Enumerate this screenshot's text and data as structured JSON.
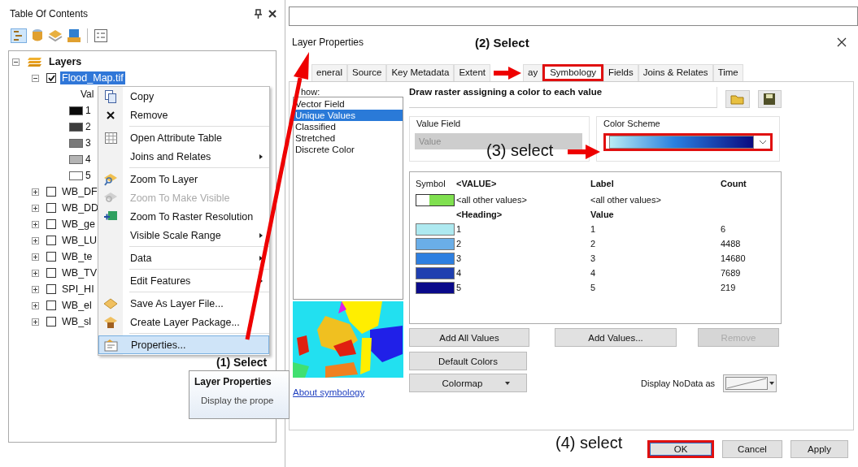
{
  "toc": {
    "title": "Table Of Contents",
    "tree": [
      {
        "label": "Layers",
        "expanded": true,
        "children": [
          {
            "label": "Flood_Map.tif",
            "checked": true,
            "selected": true,
            "expanded": true,
            "legend": {
              "heading": "Val",
              "items": [
                {
                  "label": "1",
                  "color": "#0a0a0a"
                },
                {
                  "label": "2",
                  "color": "#3c3c3c"
                },
                {
                  "label": "3",
                  "color": "#7a7a7a"
                },
                {
                  "label": "4",
                  "color": "#b4b4b4"
                },
                {
                  "label": "5",
                  "color": "#ffffff"
                }
              ]
            }
          },
          {
            "label": "WB_DF",
            "checked": false,
            "selected": false,
            "expanded": false
          },
          {
            "label": "WB_DD",
            "checked": false,
            "selected": false,
            "expanded": false
          },
          {
            "label": "WB_ge",
            "checked": false,
            "selected": false,
            "expanded": false
          },
          {
            "label": "WB_LU",
            "checked": false,
            "selected": false,
            "expanded": false
          },
          {
            "label": "WB_te",
            "checked": false,
            "selected": false,
            "expanded": false
          },
          {
            "label": "WB_TV",
            "checked": false,
            "selected": false,
            "expanded": false
          },
          {
            "label": "SPI_HI",
            "checked": false,
            "selected": false,
            "expanded": false
          },
          {
            "label": "WB_el",
            "checked": false,
            "selected": false,
            "expanded": false
          },
          {
            "label": "WB_sl",
            "checked": false,
            "selected": false,
            "expanded": false
          }
        ]
      }
    ]
  },
  "context_menu": {
    "groups": [
      [
        {
          "label": "Copy",
          "submenu": false,
          "disabled": false,
          "selected": false
        },
        {
          "label": "Remove",
          "submenu": false,
          "disabled": false,
          "selected": false
        }
      ],
      [
        {
          "label": "Open Attribute Table",
          "submenu": false,
          "disabled": false,
          "selected": false
        },
        {
          "label": "Joins and Relates",
          "submenu": true,
          "disabled": false,
          "selected": false
        }
      ],
      [
        {
          "label": "Zoom To Layer",
          "submenu": false,
          "disabled": false,
          "selected": false
        },
        {
          "label": "Zoom To Make Visible",
          "submenu": false,
          "disabled": true,
          "selected": false
        },
        {
          "label": "Zoom To Raster Resolution",
          "submenu": false,
          "disabled": false,
          "selected": false
        },
        {
          "label": "Visible Scale Range",
          "submenu": true,
          "disabled": false,
          "selected": false
        }
      ],
      [
        {
          "label": "Data",
          "submenu": true,
          "disabled": false,
          "selected": false
        }
      ],
      [
        {
          "label": "Edit Features",
          "submenu": true,
          "disabled": false,
          "selected": false
        }
      ],
      [
        {
          "label": "Save As Layer File...",
          "submenu": false,
          "disabled": false,
          "selected": false
        },
        {
          "label": "Create Layer Package...",
          "submenu": false,
          "disabled": false,
          "selected": false
        }
      ],
      [
        {
          "label": "Properties...",
          "submenu": false,
          "disabled": false,
          "selected": true
        }
      ]
    ]
  },
  "tooltip": {
    "title": "Layer Properties",
    "text": "Display the prope"
  },
  "dialog": {
    "title": "Layer Properties",
    "tabs": [
      {
        "label": "eneral",
        "selected": false,
        "highlighted": false
      },
      {
        "label": "Source",
        "selected": false,
        "highlighted": false
      },
      {
        "label": "Key Metadata",
        "selected": false,
        "highlighted": false
      },
      {
        "label": "Extent",
        "selected": false,
        "highlighted": false
      },
      {
        "label": "ay",
        "selected": false,
        "highlighted": false
      },
      {
        "label": "Symbology",
        "selected": true,
        "highlighted": true
      },
      {
        "label": "Fields",
        "selected": false,
        "highlighted": false
      },
      {
        "label": "Joins & Relates",
        "selected": false,
        "highlighted": false
      },
      {
        "label": "Time",
        "selected": false,
        "highlighted": false
      }
    ],
    "show": {
      "label": "how:",
      "items": [
        {
          "label": "Vector Field",
          "selected": false
        },
        {
          "label": "Unique Values",
          "selected": true
        },
        {
          "label": "Classified",
          "selected": false
        },
        {
          "label": "Stretched",
          "selected": false
        },
        {
          "label": "Discrete Color",
          "selected": false
        }
      ]
    },
    "about_link": "About symbology",
    "description": "Draw raster assigning a color to each value",
    "value_field": {
      "label": "Value Field",
      "value": "Value",
      "disabled": true
    },
    "color_scheme": {
      "label": "Color Scheme",
      "highlighted": true
    },
    "table": {
      "columns": [
        "Symbol",
        "<VALUE>",
        "Label",
        "Count"
      ],
      "rows": [
        {
          "kind": "other",
          "color": "#80e050",
          "value": "<all other values>",
          "label": "<all other values>"
        },
        {
          "kind": "heading",
          "value": "<Heading>",
          "label": "Value"
        },
        {
          "kind": "value",
          "color": "#aee9f0",
          "value": "1",
          "label": "1",
          "count": "6"
        },
        {
          "kind": "value",
          "color": "#6aaee8",
          "value": "2",
          "label": "2",
          "count": "4488"
        },
        {
          "kind": "value",
          "color": "#2e7fe0",
          "value": "3",
          "label": "3",
          "count": "14680"
        },
        {
          "kind": "value",
          "color": "#1f3fb0",
          "value": "4",
          "label": "4",
          "count": "7689"
        },
        {
          "kind": "value",
          "color": "#0a0a8a",
          "value": "5",
          "label": "5",
          "count": "219"
        }
      ]
    },
    "buttons": [
      {
        "label": "Add All Values",
        "disabled": false
      },
      {
        "label": "Add Values...",
        "disabled": false
      },
      {
        "label": "Remove",
        "disabled": true
      }
    ],
    "default_colors": "Default Colors",
    "colormap": "Colormap",
    "nodata_label": "Display NoData as",
    "footer": [
      {
        "label": "OK",
        "highlighted": true
      },
      {
        "label": "Cancel",
        "highlighted": false
      },
      {
        "label": "Apply",
        "highlighted": false
      }
    ]
  },
  "annotations": [
    {
      "text": "(1) Select"
    },
    {
      "text": "(2) Select"
    },
    {
      "text": "(3) select"
    },
    {
      "text": "(4) select"
    }
  ]
}
